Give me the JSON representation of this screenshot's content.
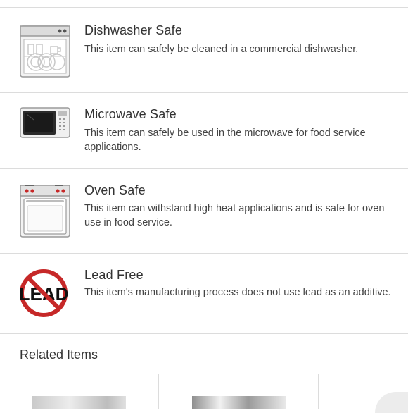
{
  "features": [
    {
      "icon": "dishwasher-icon",
      "title": "Dishwasher Safe",
      "description": "This item can safely be cleaned in a commercial dishwasher."
    },
    {
      "icon": "microwave-icon",
      "title": "Microwave Safe",
      "description": "This item can safely be used in the microwave for food service applications."
    },
    {
      "icon": "oven-icon",
      "title": "Oven Safe",
      "description": "This item can withstand high heat applications and is safe for oven use in food service."
    },
    {
      "icon": "lead-free-icon",
      "title": "Lead Free",
      "description": "This item's manufacturing process does not use lead as an additive.",
      "icon_text": "LEAD"
    }
  ],
  "related": {
    "title": "Related Items"
  }
}
